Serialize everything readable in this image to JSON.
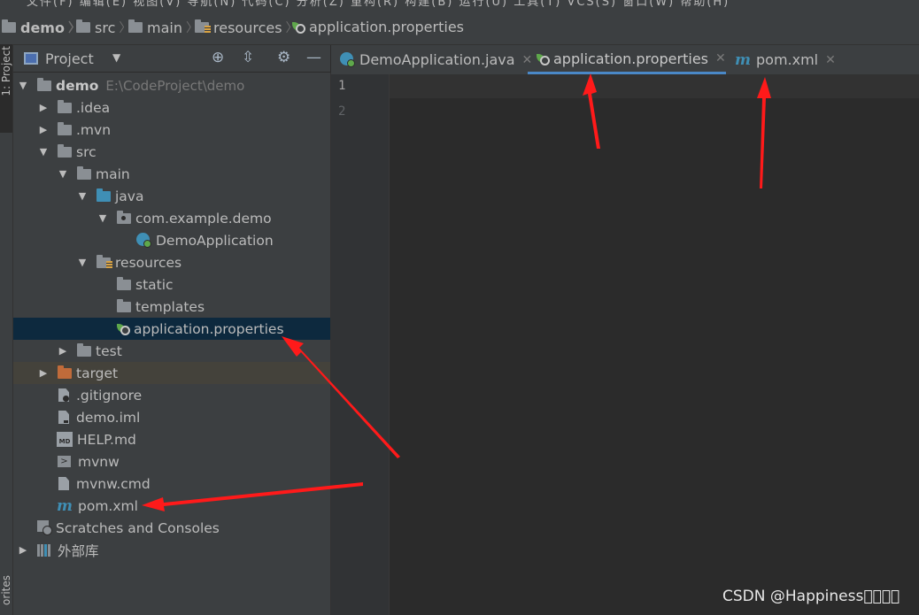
{
  "menubar": {
    "clipped_text": "文件(F) 编辑(E) 视图(V) 导航(N) 代码(C) 分析(Z) 重构(R) 构建(B) 运行(U) 工具(T) VCS(S) 窗口(W) 帮助(H)"
  },
  "breadcrumb": [
    "demo",
    "src",
    "main",
    "resources",
    "application.properties"
  ],
  "tool_window_stripe": {
    "project_label": "1: Project",
    "favorites_label": "orites"
  },
  "project_panel": {
    "title": "Project",
    "toolbar_icons": [
      "locate-icon",
      "collapse-icon",
      "gear-icon",
      "minimize-icon"
    ]
  },
  "tree": {
    "root": {
      "name": "demo",
      "path": "E:\\CodeProject\\demo"
    },
    "items": [
      ".idea",
      ".mvn",
      "src",
      "main",
      "java",
      "com.example.demo",
      "DemoApplication",
      "resources",
      "static",
      "templates",
      "application.properties",
      "test",
      "target",
      ".gitignore",
      "demo.iml",
      "HELP.md",
      "mvnw",
      "mvnw.cmd",
      "pom.xml",
      "Scratches and Consoles",
      "外部库"
    ],
    "selected": "application.properties"
  },
  "icons": {
    "md_badge": "MD",
    "terminal": ">"
  },
  "editor_tabs": [
    {
      "label": "DemoApplication.java",
      "icon": "java-class-icon",
      "active": false
    },
    {
      "label": "application.properties",
      "icon": "spring-config-icon",
      "active": true
    },
    {
      "label": "pom.xml",
      "icon": "maven-icon",
      "active": false
    }
  ],
  "editor": {
    "line_numbers": [
      "1",
      "2"
    ],
    "current_line": "1"
  },
  "watermark": "CSDN @Happiness\u0000\u0000\u0000\u0000",
  "colors": {
    "accent": "#4a88c7",
    "selection": "#0d293e",
    "annotation_arrows": "#ff1a1a",
    "spring_green": "#5fa84b"
  }
}
